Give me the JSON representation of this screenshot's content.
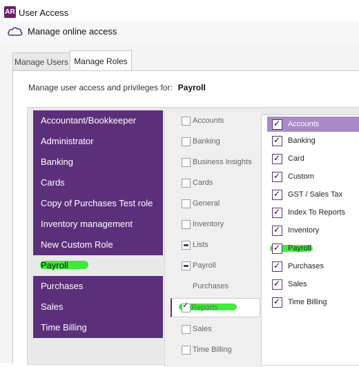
{
  "window": {
    "app_icon_text": "AR",
    "title": "User Access"
  },
  "header": {
    "title": "Manage online access"
  },
  "tabs": [
    {
      "label": "Manage Users",
      "active": false
    },
    {
      "label": "Manage Roles",
      "active": true
    }
  ],
  "instruction": {
    "text": "Manage user access and privileges for:",
    "role": "Payroll"
  },
  "roles": [
    "Accountant/Bookkeeper",
    "Administrator",
    "Banking",
    "Cards",
    "Copy of Purchases Test role",
    "Inventory management",
    "New Custom Role",
    "Payroll",
    "Purchases",
    "Sales",
    "Time Billing"
  ],
  "selected_role": "Payroll",
  "areas": [
    {
      "label": "Accounts",
      "state": "unchecked"
    },
    {
      "label": "Banking",
      "state": "unchecked"
    },
    {
      "label": "Business Insights",
      "state": "unchecked"
    },
    {
      "label": "Cards",
      "state": "unchecked"
    },
    {
      "label": "General",
      "state": "unchecked"
    },
    {
      "label": "Inventory",
      "state": "unchecked"
    },
    {
      "label": "Lists",
      "state": "partial"
    },
    {
      "label": "Payroll",
      "state": "partial"
    },
    {
      "label": "Purchases",
      "state": "none"
    },
    {
      "label": "Reports",
      "state": "checked"
    },
    {
      "label": "Sales",
      "state": "unchecked"
    },
    {
      "label": "Time Billing",
      "state": "unchecked"
    }
  ],
  "permissions": [
    {
      "label": "Accounts",
      "checked": true
    },
    {
      "label": "Banking",
      "checked": true
    },
    {
      "label": "Card",
      "checked": true
    },
    {
      "label": "Custom",
      "checked": true
    },
    {
      "label": "GST / Sales Tax",
      "checked": true
    },
    {
      "label": "Index To Reports",
      "checked": true
    },
    {
      "label": "Inventory",
      "checked": true
    },
    {
      "label": "Payroll",
      "checked": true
    },
    {
      "label": "Purchases",
      "checked": true
    },
    {
      "label": "Sales",
      "checked": true
    },
    {
      "label": "Time Billing",
      "checked": true
    }
  ],
  "colors": {
    "role_bg": "#5c2f7b",
    "active_permission_bg": "#a98bc7",
    "highlight": "#22e81a"
  }
}
